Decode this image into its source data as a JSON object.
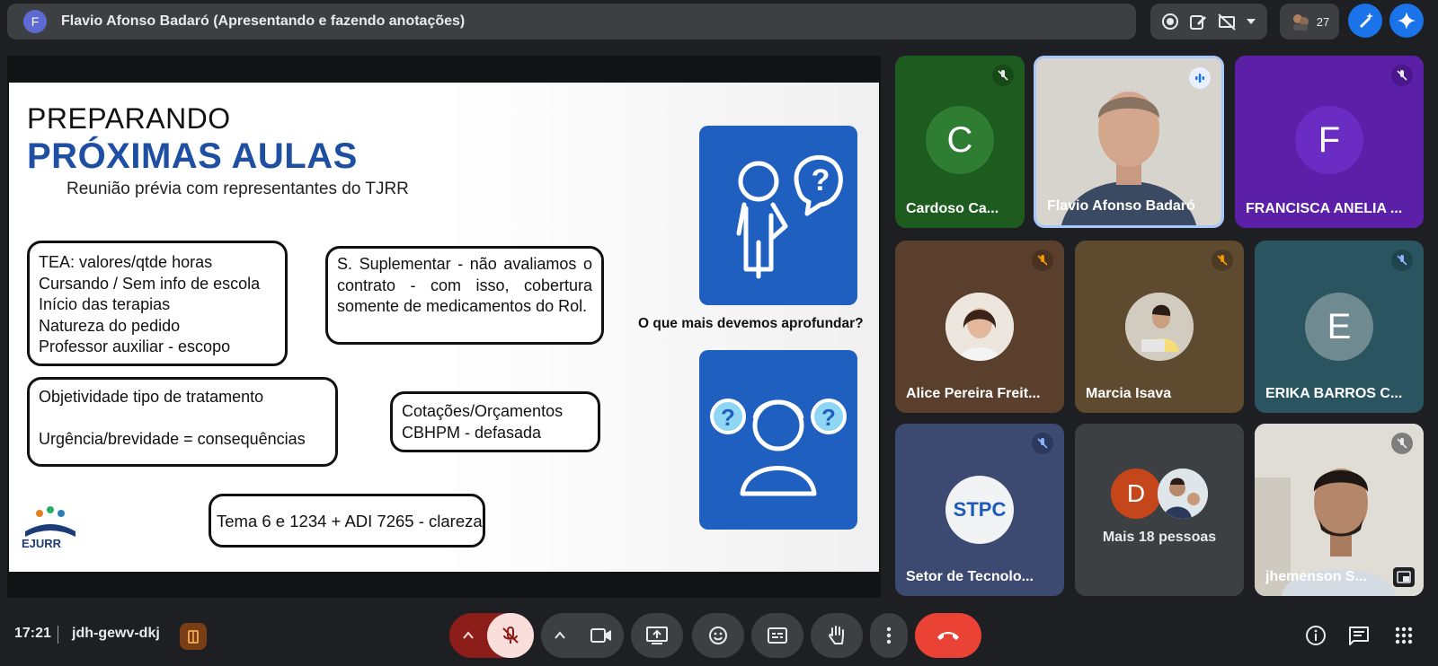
{
  "topbar": {
    "presenter_initial": "F",
    "presenter_title": "Flavio Afonso Badaró (Apresentando e fazendo anotações)",
    "participant_count": "27"
  },
  "slide": {
    "title_line1": "PREPARANDO",
    "title_line2": "PRÓXIMAS AULAS",
    "subtitle": "Reunião prévia com representantes do TJRR",
    "box1_lines": [
      "TEA: valores/qtde horas",
      "Cursando / Sem info de escola",
      "Início das terapias",
      "Natureza do pedido",
      "Professor auxiliar - escopo"
    ],
    "box2_text": "S. Suplementar - não avaliamos o contrato - com isso, cobertura somente de medicamentos do Rol.",
    "box3_line1": "Objetividade tipo de tratamento",
    "box3_line2": "Urgência/brevidade = consequências",
    "box4_line1": "Cotações/Orçamentos",
    "box4_line2": "CBHPM - defasada",
    "box5_text": "Tema 6 e 1234 + ADI 7265 - clareza",
    "question_label": "O que mais devemos aprofundar?",
    "logo_text": "EJURR"
  },
  "tiles": [
    {
      "name": "Cardoso Ca...",
      "initial": "C",
      "bg": "#1e5b1e",
      "avatar_bg": "#2e7d32",
      "muted": true
    },
    {
      "name": "Flavio Afonso Badaró",
      "speaking": true
    },
    {
      "name": "FRANCISCA ANELIA ...",
      "initial": "F",
      "bg": "#5b1fa8",
      "avatar_bg": "#6a2cc2",
      "muted": true
    },
    {
      "name": "Alice Pereira Freit...",
      "muted": true
    },
    {
      "name": "Marcia Isava",
      "muted": true
    },
    {
      "name": "ERIKA BARROS C...",
      "initial": "E",
      "bg": "#2a5560",
      "avatar_bg": "#6f8a91",
      "muted": true
    },
    {
      "name": "Setor de Tecnolo...",
      "logo_text": "STPC",
      "muted": true
    },
    {
      "name": "Mais 18 pessoas",
      "initial": "D"
    },
    {
      "name": "jhemenson S...",
      "muted": true
    }
  ],
  "bottombar": {
    "time": "17:21",
    "meeting_code": "jdh-gewv-dkj"
  },
  "colors": {
    "end_call": "#ea4335",
    "mic_muted_bg": "#f9dedc",
    "mic_group_bg": "#8c1d18",
    "accent_blue": "#1f5fbf"
  }
}
